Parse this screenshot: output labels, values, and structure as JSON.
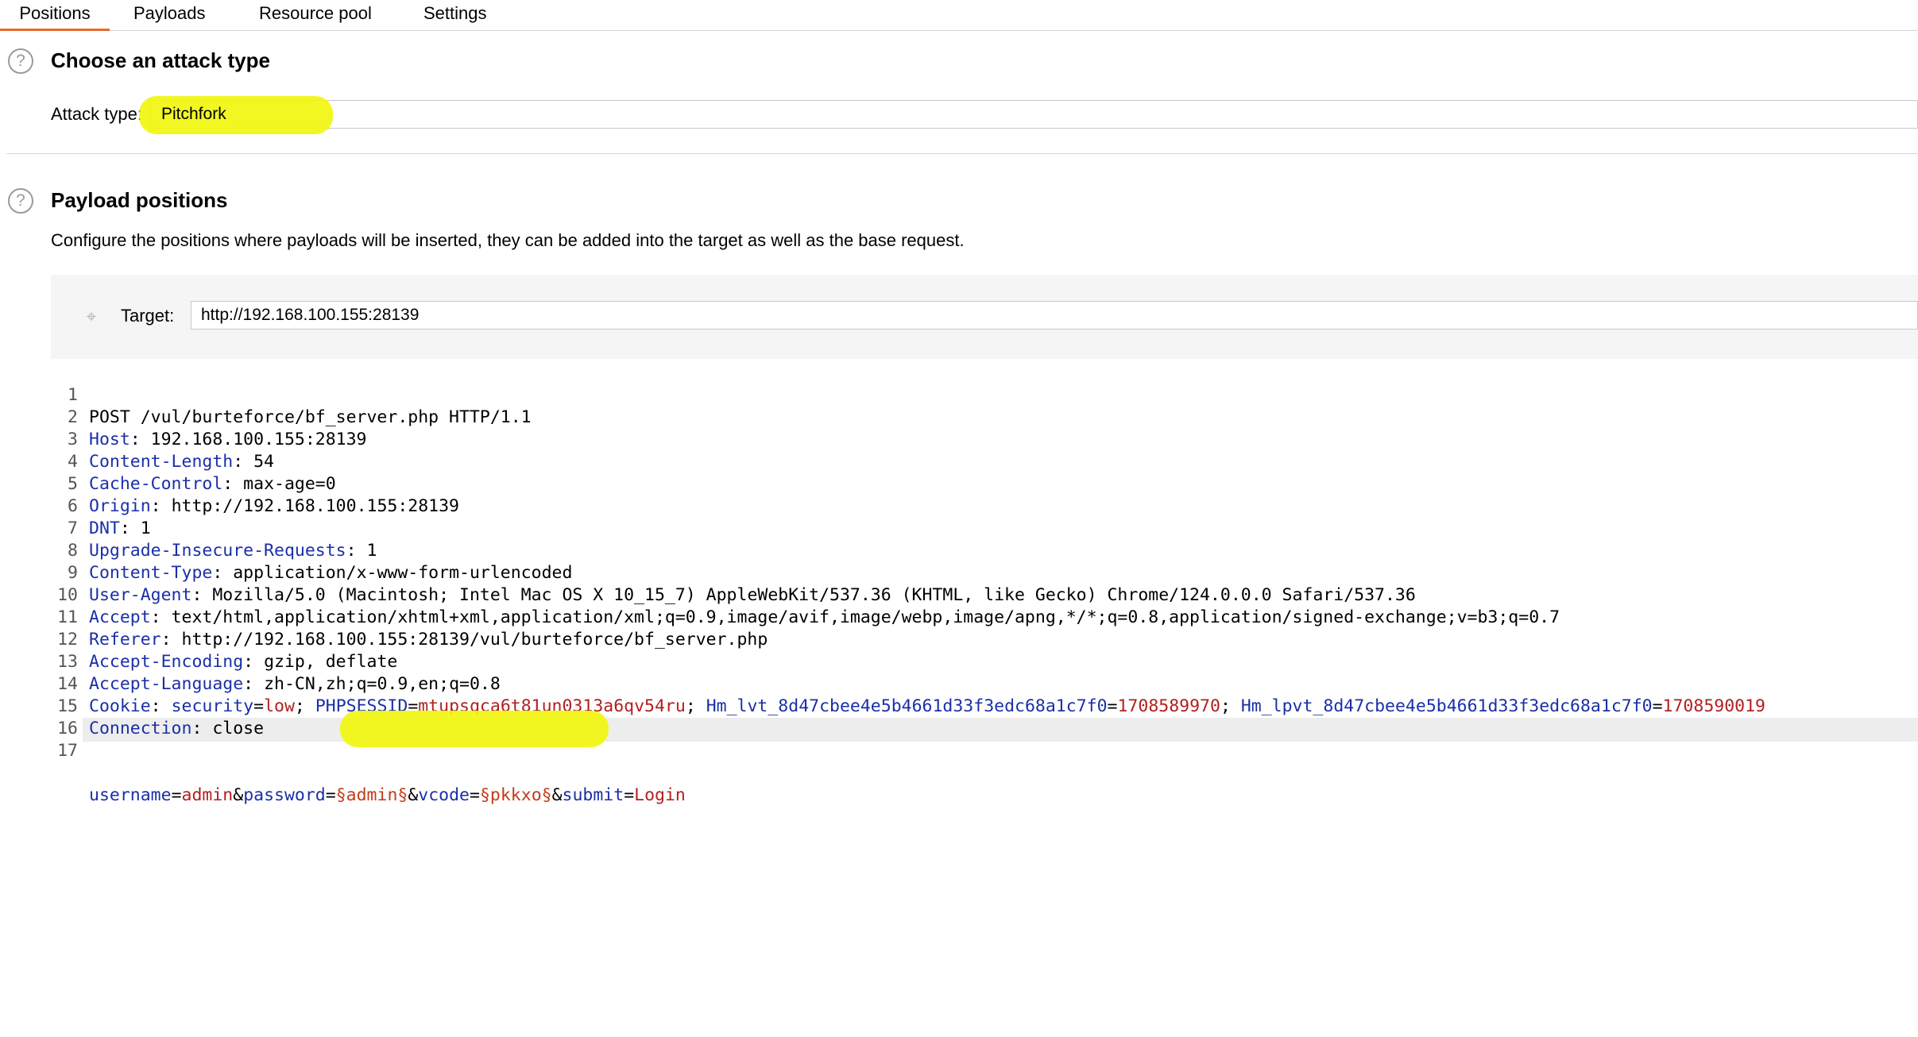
{
  "tabs": [
    {
      "label": "Positions",
      "active": true
    },
    {
      "label": "Payloads",
      "active": false
    },
    {
      "label": "Resource pool",
      "active": false
    },
    {
      "label": "Settings",
      "active": false
    }
  ],
  "attack_section": {
    "help": "?",
    "title": "Choose an attack type",
    "attack_type_label": "Attack type:",
    "attack_type_value": "Pitchfork"
  },
  "positions_section": {
    "help": "?",
    "title": "Payload positions",
    "description": "Configure the positions where payloads will be inserted, they can be added into the target as well as the base request.",
    "target_label": "Target:",
    "target_value": "http://192.168.100.155:28139"
  },
  "colors": {
    "accent": "#e8672f",
    "highlight": "#f1f60a",
    "header_name": "#1a2fa8",
    "param_value": "#b21f1f"
  },
  "icons": {
    "help": "help-circle-icon",
    "target": "crosshair-icon"
  },
  "request": {
    "line1": "POST /vul/burteforce/bf_server.php HTTP/1.1",
    "headers": [
      {
        "name": "Host",
        "value": " 192.168.100.155:28139"
      },
      {
        "name": "Content-Length",
        "value": " 54"
      },
      {
        "name": "Cache-Control",
        "value": " max-age=0"
      },
      {
        "name": "Origin",
        "value": " http://192.168.100.155:28139"
      },
      {
        "name": "DNT",
        "value": " 1"
      },
      {
        "name": "Upgrade-Insecure-Requests",
        "value": " 1"
      },
      {
        "name": "Content-Type",
        "value": " application/x-www-form-urlencoded"
      },
      {
        "name": "User-Agent",
        "value": " Mozilla/5.0 (Macintosh; Intel Mac OS X 10_15_7) AppleWebKit/537.36 (KHTML, like Gecko) Chrome/124.0.0.0 Safari/537.36"
      },
      {
        "name": "Accept",
        "value": " text/html,application/xhtml+xml,application/xml;q=0.9,image/avif,image/webp,image/apng,*/*;q=0.8,application/signed-exchange;v=b3;q=0.7"
      },
      {
        "name": "Referer",
        "value": " http://192.168.100.155:28139/vul/burteforce/bf_server.php"
      },
      {
        "name": "Accept-Encoding",
        "value": " gzip, deflate"
      },
      {
        "name": "Accept-Language",
        "value": " zh-CN,zh;q=0.9,en;q=0.8"
      }
    ],
    "cookie_header": "Cookie",
    "cookies": [
      {
        "name": "security",
        "value": "low"
      },
      {
        "name": "PHPSESSID",
        "value": "mtupsqca6t81un0313a6qv54ru"
      },
      {
        "name": "Hm_lvt_8d47cbee4e5b4661d33f3edc68a1c7f0",
        "value": "1708589970"
      },
      {
        "name": "Hm_lpvt_8d47cbee4e5b4661d33f3edc68a1c7f0",
        "value": "1708590019"
      }
    ],
    "connection_header": "Connection",
    "connection_value": " close",
    "body": {
      "p1_name": "username",
      "p1_value": "admin",
      "p2_name": "password",
      "p2_payload": "§admin§",
      "p3_name": "vcode",
      "p3_payload": "§pkkxo§",
      "p4_name": "submit",
      "p4_value": "Login"
    },
    "line_numbers": [
      "1",
      "2",
      "3",
      "4",
      "5",
      "6",
      "7",
      "8",
      "9",
      "10",
      "11",
      "12",
      "13",
      "14",
      "15",
      "16",
      "17"
    ]
  }
}
